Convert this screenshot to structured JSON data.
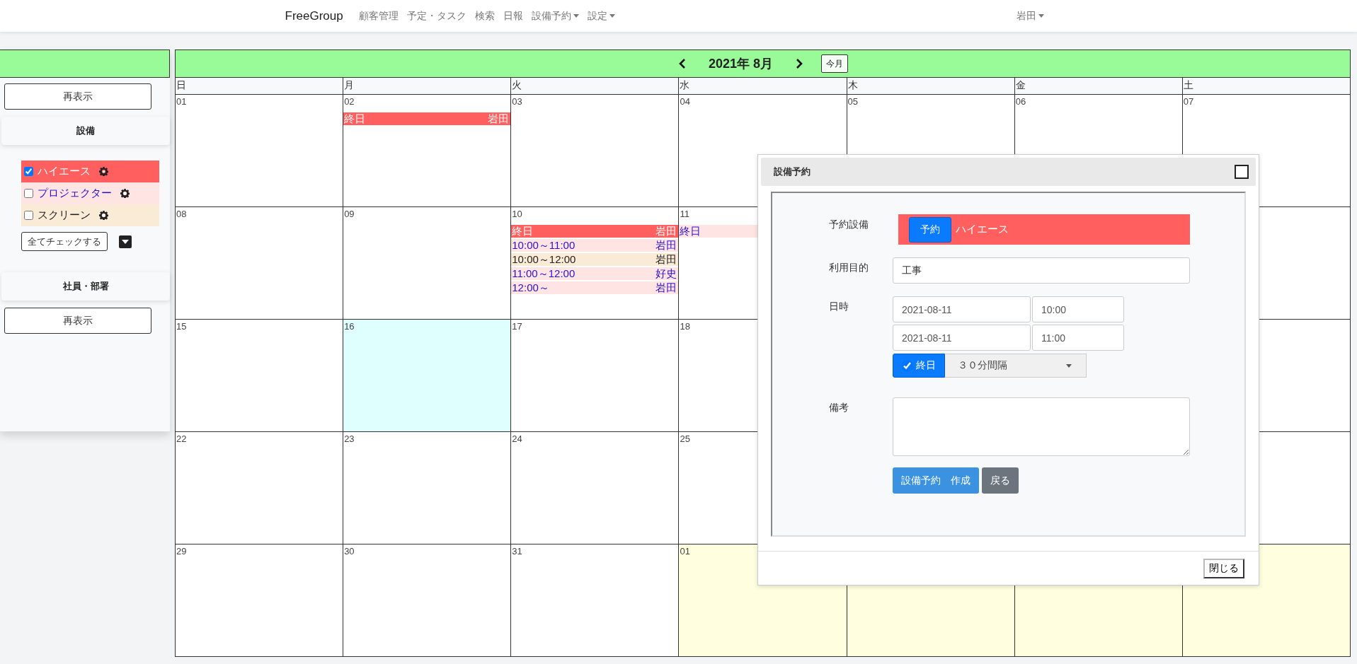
{
  "navbar": {
    "brand": "FreeGroup",
    "items": [
      {
        "label": "顧客管理"
      },
      {
        "label": "予定・タスク"
      },
      {
        "label": "検索"
      },
      {
        "label": "日報"
      },
      {
        "label": "設備予約",
        "dropdown": true
      },
      {
        "label": "設定",
        "dropdown": true
      }
    ],
    "user": {
      "label": "岩田",
      "dropdown": true
    }
  },
  "sidebar": {
    "refresh_button": "再表示",
    "equipment_section": {
      "title": "設備",
      "items": [
        {
          "name": "ハイエース",
          "checked": true,
          "color": "#ff5f5f"
        },
        {
          "name": "プロジェクター",
          "checked": false,
          "color": "#ffe4e4"
        },
        {
          "name": "スクリーン",
          "checked": false,
          "color": "#faebd7"
        }
      ],
      "check_all_button": "全てチェックする"
    },
    "staff_section": {
      "title": "社員・部署",
      "refresh_button": "再表示"
    }
  },
  "calendar": {
    "title": "2021年 8月",
    "today_button": "今月",
    "weekdays": [
      "日",
      "月",
      "火",
      "水",
      "木",
      "金",
      "土"
    ],
    "weeks": [
      [
        {
          "date": "01",
          "today": false,
          "other_month": false
        },
        {
          "date": "02",
          "today": false,
          "other_month": false,
          "events": [
            {
              "time": "終日",
              "person": "岩田",
              "color": "#ff5f5f"
            }
          ]
        },
        {
          "date": "03",
          "today": false,
          "other_month": false
        },
        {
          "date": "04",
          "today": false,
          "other_month": false
        },
        {
          "date": "05",
          "today": false,
          "other_month": false
        },
        {
          "date": "06",
          "today": false,
          "other_month": false
        },
        {
          "date": "07",
          "today": false,
          "other_month": false
        }
      ],
      [
        {
          "date": "08",
          "today": false,
          "other_month": false
        },
        {
          "date": "09",
          "today": false,
          "other_month": false
        },
        {
          "date": "10",
          "today": false,
          "other_month": false,
          "events": [
            {
              "time": "終日",
              "person": "岩田",
              "color": "#ff5f5f"
            },
            {
              "time": "10:00～11:00",
              "person": "岩田",
              "color": "#ffe4e4"
            },
            {
              "time": "10:00～12:00",
              "person": "岩田",
              "color": "#faebd7"
            },
            {
              "time": "11:00～12:00",
              "person": "好史",
              "color": "#ffe4e4"
            },
            {
              "time": "12:00～",
              "person": "岩田",
              "color": "#ffe4e4"
            }
          ]
        },
        {
          "date": "11",
          "today": false,
          "other_month": false,
          "events": [
            {
              "time": "終日",
              "color": "#ffe4e4"
            }
          ]
        }
      ],
      [
        {
          "date": "15",
          "today": false,
          "other_month": false
        },
        {
          "date": "16",
          "today": true,
          "other_month": false
        },
        {
          "date": "17",
          "today": false,
          "other_month": false
        },
        {
          "date": "18",
          "today": false,
          "other_month": false
        }
      ],
      [
        {
          "date": "22",
          "today": false,
          "other_month": false
        },
        {
          "date": "23",
          "today": false,
          "other_month": false
        },
        {
          "date": "24",
          "today": false,
          "other_month": false
        },
        {
          "date": "25",
          "today": false,
          "other_month": false
        }
      ],
      [
        {
          "date": "29",
          "today": false,
          "other_month": false
        },
        {
          "date": "30",
          "today": false,
          "other_month": false
        },
        {
          "date": "31",
          "today": false,
          "other_month": false
        },
        {
          "date": "01",
          "today": false,
          "other_month": true
        },
        {
          "today": false,
          "other_month": true
        },
        {
          "today": false,
          "other_month": true
        },
        {
          "today": false,
          "other_month": true
        }
      ]
    ]
  },
  "dialog": {
    "title": "設備予約",
    "equipment": {
      "label": "予約設備",
      "button": "予約",
      "name": "ハイエース",
      "color": "#ff5f5f"
    },
    "purpose": {
      "label": "利用目的",
      "value": "工事"
    },
    "datetime": {
      "label": "日時",
      "start_date": "2021-08-11",
      "start_time": "10:00",
      "end_date": "2021-08-11",
      "end_time": "11:00",
      "all_day": {
        "label": "終日",
        "checked": true
      },
      "interval": "３０分間隔"
    },
    "notes": {
      "label": "備考"
    },
    "create_button": "設備予約　作成",
    "back_button": "戻る",
    "close_button": "閉じる"
  }
}
